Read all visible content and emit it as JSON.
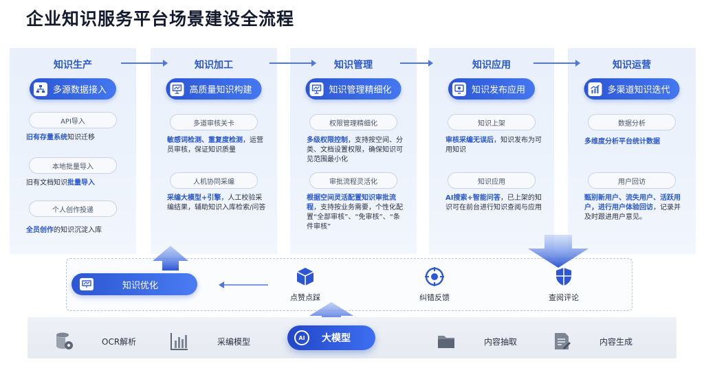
{
  "title": "企业知识服务平台场景建设全流程",
  "columns": [
    {
      "head": "知识生产",
      "main": "多源数据接入",
      "subs": [
        "API导入",
        "本地批量导入",
        "个人创作投递"
      ],
      "descs": [
        {
          "b": "旧有存量系统",
          "t": "知识迁移"
        },
        {
          "t": "旧有文档知识",
          "b": "批量导入"
        },
        {
          "b": "全员创作",
          "t": "的知识沉淀入库"
        }
      ]
    },
    {
      "head": "知识加工",
      "main": "高质量知识构建",
      "subs": [
        "多道审核关卡",
        "人机协同采编"
      ],
      "descs": [
        {
          "b": "敏感词检测、重复度检测",
          "t": "，运营员审核，保证知识质量"
        },
        {
          "b": "采编大模型+引擎",
          "t": "，人工校验采编结果，辅助知识入库检索/问答"
        }
      ]
    },
    {
      "head": "知识管理",
      "main": "知识管理精细化",
      "subs": [
        "权限管理精细化",
        "审批流程灵活化"
      ],
      "descs": [
        {
          "b": "多级权限控制",
          "t": "，支持按空间、分类、文档设置权限，确保知识可见范围最小化"
        },
        {
          "b": "根据空间灵活配置知识审批流程",
          "t": "，支持按业务需要，个性化配置“全部审核”、“免审核”、“条件审核”"
        }
      ]
    },
    {
      "head": "知识应用",
      "main": "知识发布应用",
      "subs": [
        "知识上架",
        "知识应用"
      ],
      "descs": [
        {
          "b": "审核采编无误后",
          "t": "，知识发布为可用知识"
        },
        {
          "b": "AI搜索+智能问答",
          "t": "，已上架的知识可在前台进行知识查阅与应用"
        }
      ]
    },
    {
      "head": "知识运营",
      "main": "多渠道知识迭代",
      "subs": [
        "数据分析",
        "用户回访"
      ],
      "descs": [
        {
          "b": "多维度分析平台统计数据",
          "t": ""
        },
        {
          "b": "甄别新用户、流失用户、活跃用户，进行用户体验回访",
          "t": "，记录并及时跟进用户意见。"
        }
      ]
    }
  ],
  "feedback": {
    "optimize": "知识优化",
    "items": [
      "点赞点踩",
      "纠错反馈",
      "查阅评论"
    ]
  },
  "bottom": {
    "items": [
      "OCR解析",
      "采编模型",
      "内容抽取",
      "内容生成"
    ],
    "model": "大模型",
    "model_icon_text": "AI"
  },
  "icons": {
    "col_icons": [
      "org-chart-icon",
      "presentation-icon",
      "presentation-icon",
      "monitor-icon",
      "growth-chart-icon"
    ],
    "feedback_icons": [
      "cube-icon",
      "target-icon",
      "shield-icon"
    ],
    "bottom_icons": [
      "database-settings-icon",
      "bar-chart-icon",
      "folder-icon",
      "document-edit-icon"
    ]
  },
  "colors": {
    "accent": "#2c56d4",
    "accent_text": "#2a57c9",
    "column_bg": "#e9f0fb"
  }
}
